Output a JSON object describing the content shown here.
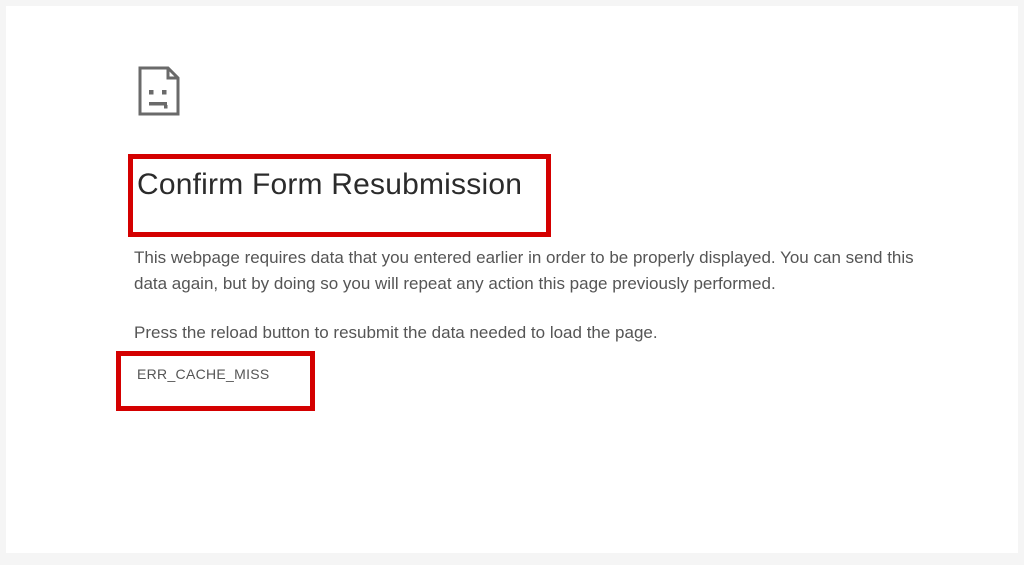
{
  "error_page": {
    "title": "Confirm Form Resubmission",
    "description": "This webpage requires data that you entered earlier in order to be properly displayed. You can send this data again, but by doing so you will repeat any action this page previously performed.",
    "instruction": "Press the reload button to resubmit the data needed to load the page.",
    "error_code": "ERR_CACHE_MISS",
    "icon_name": "sad-file-icon",
    "highlight_color": "#d40000"
  }
}
